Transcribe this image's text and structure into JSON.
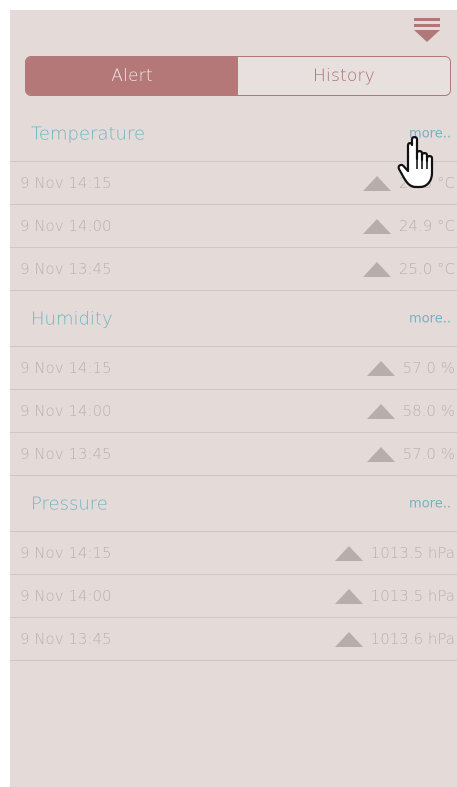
{
  "tabs": {
    "alert_label": "Alert",
    "history_label": "History"
  },
  "sections": [
    {
      "title": "Temperature",
      "more": "more..",
      "rows": [
        {
          "time": "9 Nov 14:15",
          "value": "25.3 °C"
        },
        {
          "time": "9 Nov 14:00",
          "value": "24.9 °C"
        },
        {
          "time": "9 Nov 13:45",
          "value": "25.0 °C"
        }
      ]
    },
    {
      "title": "Humidity",
      "more": "more..",
      "rows": [
        {
          "time": "9 Nov 14:15",
          "value": "57.0 %"
        },
        {
          "time": "9 Nov 14:00",
          "value": "58.0 %"
        },
        {
          "time": "9 Nov 13:45",
          "value": "57.0 %"
        }
      ]
    },
    {
      "title": "Pressure",
      "more": "more..",
      "rows": [
        {
          "time": "9 Nov 14:15",
          "value": "1013.5 hPa"
        },
        {
          "time": "9 Nov 14:00",
          "value": "1013.5 hPa"
        },
        {
          "time": "9 Nov 13:45",
          "value": "1013.6 hPa"
        }
      ]
    }
  ],
  "icons": {
    "menu": "menu-dropdown-icon",
    "trend": "triangle-up-icon",
    "cursor": "hand-pointer-cursor"
  },
  "colors": {
    "background": "#e4dbd9",
    "accent": "#b37877",
    "section_title": "#6fb4c2",
    "muted_text": "#b9b0af"
  }
}
